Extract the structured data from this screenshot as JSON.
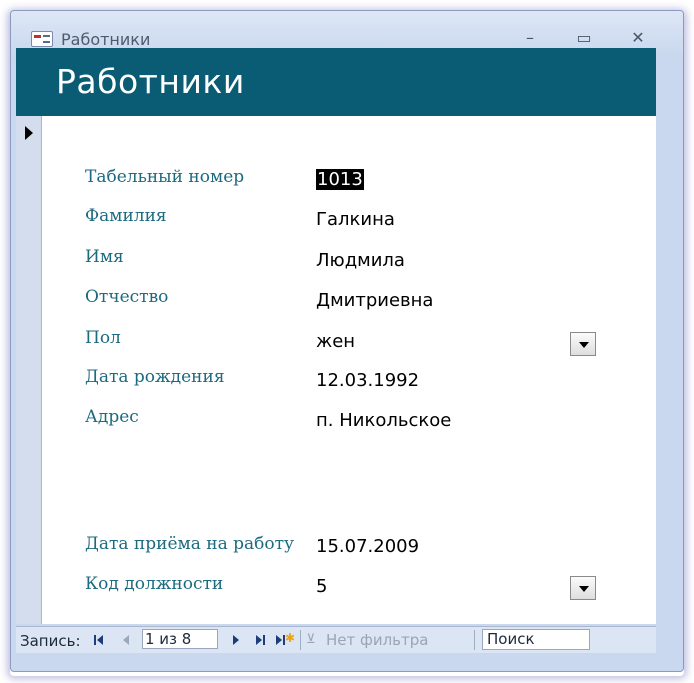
{
  "window": {
    "title": "Работники",
    "minimize_glyph": "–",
    "maximize_glyph": "▭",
    "close_glyph": "✕"
  },
  "form": {
    "header_title": "Работники",
    "fields": [
      {
        "label": "Табельный номер",
        "value": "1013"
      },
      {
        "label": "Фамилия",
        "value": "Галкина"
      },
      {
        "label": "Имя",
        "value": "Людмила"
      },
      {
        "label": "Отчество",
        "value": "Дмитриевна"
      },
      {
        "label": "Пол",
        "value": "жен"
      },
      {
        "label": "Дата рождения",
        "value": "12.03.1992"
      },
      {
        "label": "Адрес",
        "value": "п. Никольское"
      },
      {
        "label": "Дата приёма на работу",
        "value": "15.07.2009"
      },
      {
        "label": "Код должности",
        "value": "5"
      }
    ]
  },
  "navigation": {
    "record_label": "Запись:",
    "record_position": "1 из 8",
    "filter_label": "Нет фильтра",
    "search_label": "Поиск"
  },
  "colors": {
    "header_band": "#0a5c74",
    "label_text": "#1c6a7f",
    "window_frame": "#c9d8ee"
  }
}
